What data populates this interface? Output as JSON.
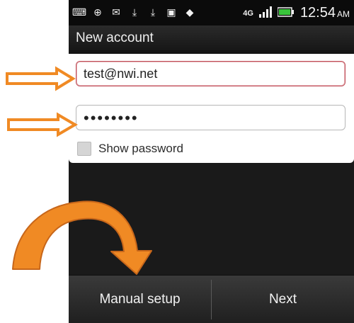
{
  "status_bar": {
    "icons_left": [
      "keyboard-icon",
      "download-arrow-icon",
      "gmail-icon",
      "download-icon",
      "download-icon",
      "image-icon",
      "app-icon"
    ],
    "network": "4G",
    "time": "12:54",
    "ampm": "AM"
  },
  "header": {
    "title": "New account"
  },
  "form": {
    "email_value": "test@nwi.net",
    "password_masked": "••••••••",
    "show_password_label": "Show password"
  },
  "buttons": {
    "manual_setup": "Manual setup",
    "next": "Next"
  },
  "colors": {
    "annotation_orange": "#F08A24",
    "email_border": "#C0505A"
  }
}
